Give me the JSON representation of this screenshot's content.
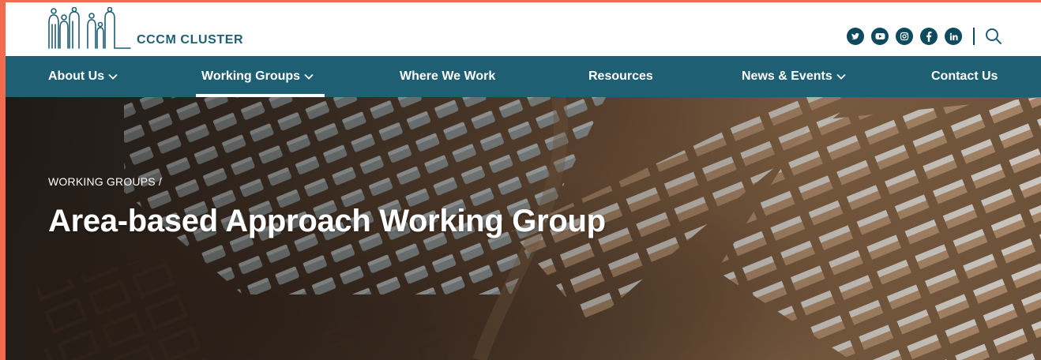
{
  "brand": {
    "name": "CCCM CLUSTER",
    "color": "#1e5f74",
    "nav_bg": "#1e5f74",
    "accent_frame": "#f26b4f"
  },
  "social": [
    {
      "name": "twitter-icon",
      "glyph": "t"
    },
    {
      "name": "youtube-icon",
      "glyph": "▶"
    },
    {
      "name": "instagram-icon",
      "glyph": "◎"
    },
    {
      "name": "facebook-icon",
      "glyph": "f"
    },
    {
      "name": "linkedin-icon",
      "glyph": "in"
    }
  ],
  "nav": {
    "items": [
      {
        "label": "About Us",
        "has_dropdown": true
      },
      {
        "label": "Working Groups",
        "has_dropdown": true,
        "active": true
      },
      {
        "label": "Where We Work",
        "has_dropdown": false
      },
      {
        "label": "Resources",
        "has_dropdown": false
      },
      {
        "label": "News & Events",
        "has_dropdown": true
      },
      {
        "label": "Contact Us",
        "has_dropdown": false
      }
    ]
  },
  "hero": {
    "breadcrumb": "WORKING GROUPS /",
    "title": "Area-based Approach Working Group"
  }
}
